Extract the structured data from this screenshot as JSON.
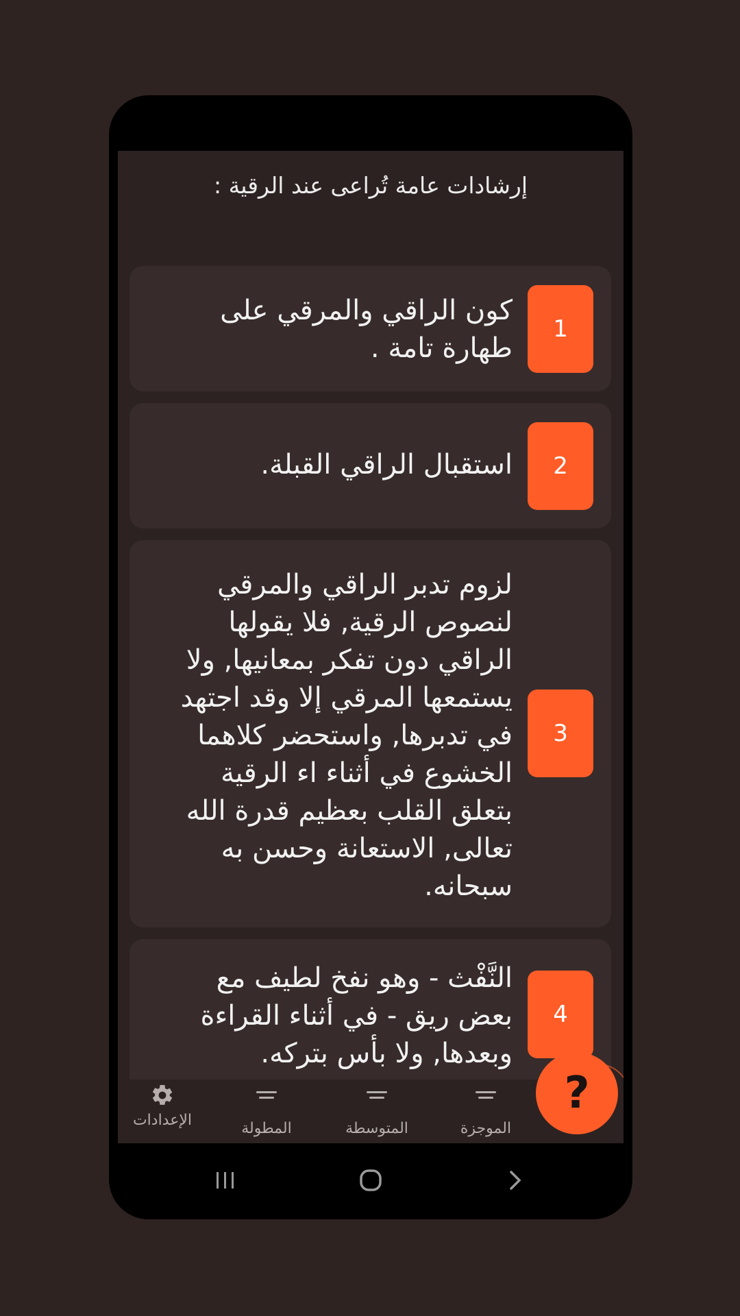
{
  "header": {
    "title": "إرشادات عامة تُراعى عند الرقية :"
  },
  "items": [
    {
      "number": "1",
      "text": "كون الراقي والمرقي على طهارة تامة ."
    },
    {
      "number": "2",
      "text": "استقبال الراقي القبلة."
    },
    {
      "number": "3",
      "text": "لزوم تدبر الراقي والمرقي لنصوص الرقية, فلا يقولها الراقي دون تفكر بمعانيها, ولا يستمعها المرقي إلا وقد اجتهد في تدبرها, واستحضر كلاهما الخشوع في أثناء اء الرقية بتعلق القلب بعظيم قدرة الله تعالى, الاستعانة وحسن به سبحانه."
    },
    {
      "number": "4",
      "text": "النَّفْث - وهو نفخ لطيف مع بعض ريق - في أثناء القراءة وبعدها, ولا بأس بتركه."
    }
  ],
  "bottom_nav": {
    "items": [
      {
        "label": "الإعدادات",
        "icon": "gear-icon"
      },
      {
        "label": "المطولة",
        "icon": "short-lines-icon"
      },
      {
        "label": "المتوسطة",
        "icon": "short-lines-icon"
      },
      {
        "label": "الموجزة",
        "icon": "short-lines-icon"
      }
    ],
    "fab_label": "?"
  },
  "colors": {
    "accent": "#ff5c27",
    "background": "#2c2221",
    "card": "#372c2b"
  }
}
